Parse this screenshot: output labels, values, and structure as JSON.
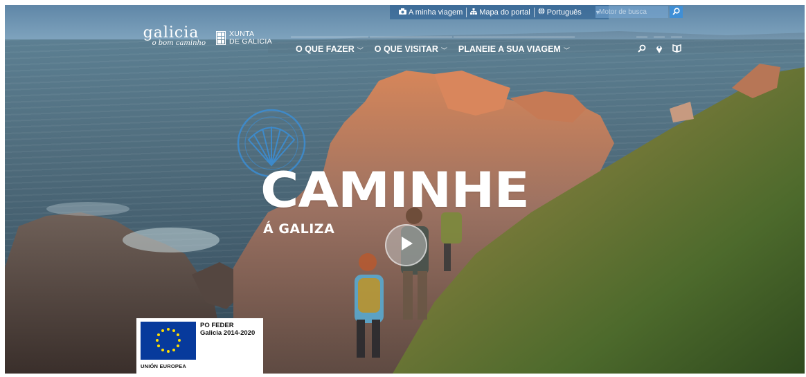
{
  "topbar": {
    "my_trip": "A minha viagem",
    "portal_map": "Mapa do portal",
    "language": "Português",
    "search_placeholder": "Motor de busca"
  },
  "brand": {
    "logo_word": "galicia",
    "logo_tagline": "o bom caminho",
    "xunta_line1": "XUNTA",
    "xunta_line2": "DE GALICIA"
  },
  "nav": {
    "items": [
      {
        "label": "O QUE FAZER"
      },
      {
        "label": "O QUE VISITAR"
      },
      {
        "label": "PLANEIE A SUA VIAGEM"
      }
    ],
    "icons": [
      "search-icon",
      "map-pin-icon",
      "book-icon"
    ]
  },
  "hero": {
    "title": "CAMINHE",
    "subtitle": "Á GALIZA"
  },
  "eu_badge": {
    "line1": "PO FEDER",
    "line2": "Galicia 2014-2020",
    "caption": "UNIÓN EUROPEA"
  },
  "colors": {
    "accent": "#3f8fd6",
    "eu_blue": "#073a9c",
    "eu_star": "#ffdd00"
  }
}
